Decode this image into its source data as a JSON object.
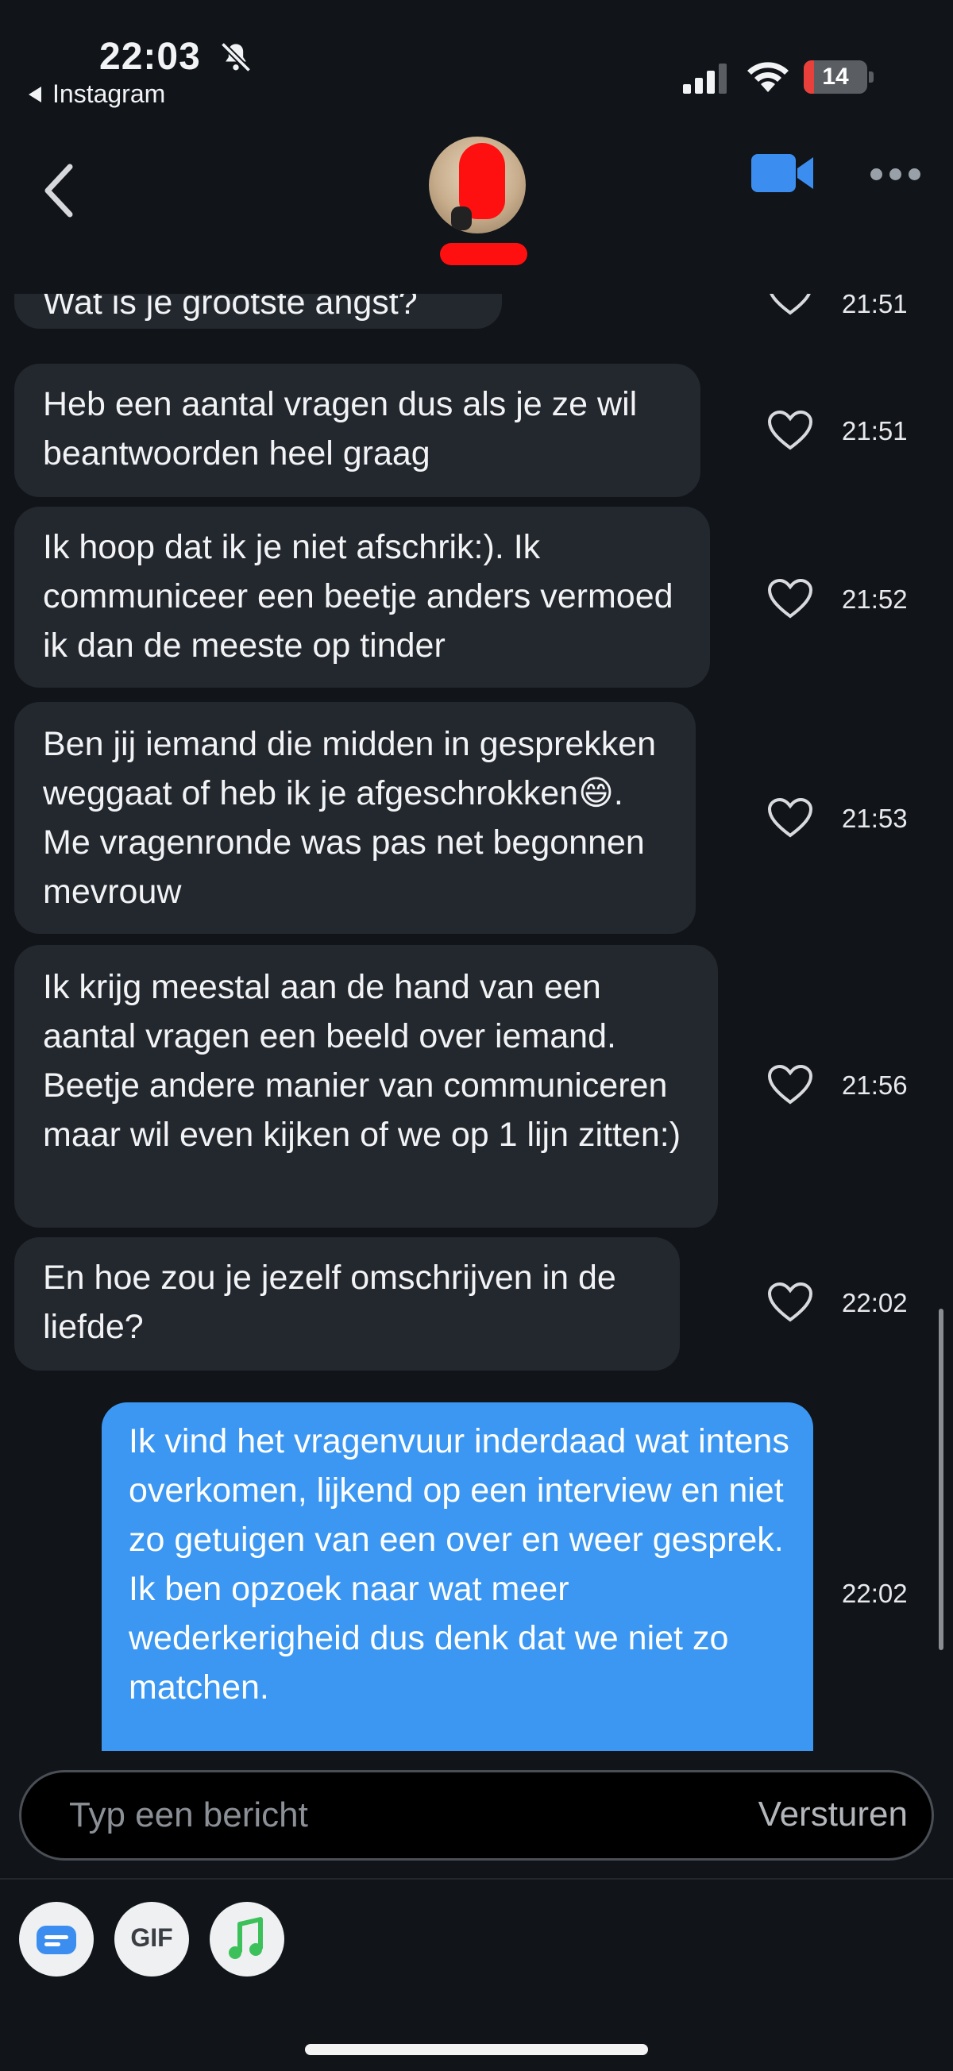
{
  "status_bar": {
    "time": "22:03",
    "back_app": "Instagram",
    "battery": "14"
  },
  "header": {
    "contact_name": "",
    "icons": [
      "chevron-left-icon",
      "video-camera-icon",
      "more-horizontal-icon"
    ]
  },
  "messages": [
    {
      "dir": "received",
      "text": "Wat is je grootste angst?",
      "time": "21:51"
    },
    {
      "dir": "received",
      "text": "Heb een aantal vragen dus als je ze wil beantwoorden heel graag",
      "time": "21:51"
    },
    {
      "dir": "received",
      "text": "Ik hoop dat ik je niet afschrik:). Ik communiceer een beetje anders vermoed ik dan de meeste op tinder",
      "time": "21:52"
    },
    {
      "dir": "received",
      "text": "Ben jij iemand die midden in gesprekken weggaat of heb ik je afgeschrokken😄. Me vragenronde was pas net begonnen mevrouw",
      "time": "21:53"
    },
    {
      "dir": "received",
      "text": "Ik krijg meestal aan de hand van een aantal vragen een beeld over iemand. Beetje andere manier van communiceren maar wil even kijken of we op 1 lijn zitten:)",
      "time": "21:56"
    },
    {
      "dir": "received",
      "text": "En hoe zou je jezelf omschrijven in de liefde?",
      "time": "22:02"
    },
    {
      "dir": "sent",
      "text": "Ik vind het vragenvuur inderdaad wat intens overkomen, lijkend op een interview en niet zo getuigen van een over en weer gesprek. Ik ben opzoek naar wat meer wederkerigheid dus denk dat we niet zo matchen.",
      "time": "22:02"
    }
  ],
  "composer": {
    "placeholder": "Typ een bericht",
    "send_label": "Versturen"
  },
  "toolbar": {
    "gif_label": "GIF",
    "icons": [
      "sticker-icon",
      "gif-icon",
      "music-icon"
    ]
  },
  "colors": {
    "background": "#111419",
    "received_bubble": "#23272e",
    "sent_bubble": "#3b97f2",
    "video_icon": "#3b8ef0",
    "redaction": "#ff1010"
  }
}
